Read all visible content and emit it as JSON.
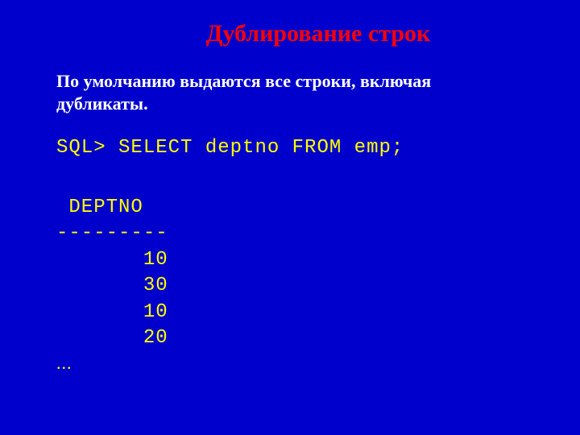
{
  "title": "Дублирование строк",
  "subtitle": "По умолчанию выдаются все строки, включая дубликаты.",
  "sql": {
    "prompt": "SQL>",
    "query": "SELECT deptno FROM emp;"
  },
  "output": {
    "header": " DEPTNO",
    "divider": "---------",
    "rows": [
      "       10",
      "       30",
      "       10",
      "       20"
    ],
    "ellipsis": "..."
  }
}
